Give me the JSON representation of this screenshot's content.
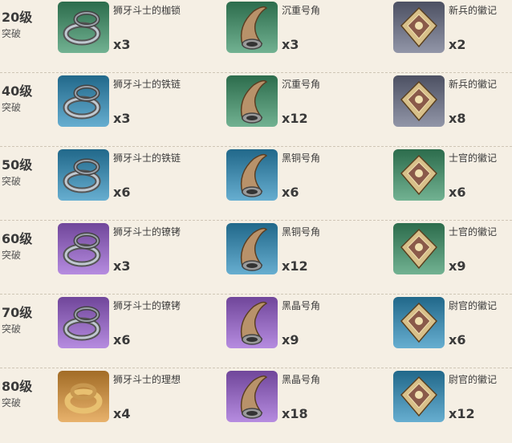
{
  "rows": [
    {
      "level": "20级",
      "sub": "突破",
      "items": [
        {
          "name": "狮牙斗士的枷锁",
          "count": "x3",
          "bg": "#4a8a6a",
          "icon": "shackle-icon"
        },
        {
          "name": "沉重号角",
          "count": "x3",
          "bg": "#4a8a6a",
          "icon": "horn-icon"
        },
        {
          "name": "新兵的徽记",
          "count": "x2",
          "bg": "#6a6e80",
          "icon": "insignia-icon"
        }
      ]
    },
    {
      "level": "40级",
      "sub": "突破",
      "items": [
        {
          "name": "狮牙斗士的铁链",
          "count": "x3",
          "bg": "#3f86a8",
          "icon": "chain-icon"
        },
        {
          "name": "沉重号角",
          "count": "x12",
          "bg": "#4a8a6a",
          "icon": "horn-icon"
        },
        {
          "name": "新兵的徽记",
          "count": "x8",
          "bg": "#6a6e80",
          "icon": "insignia-icon"
        }
      ]
    },
    {
      "level": "50级",
      "sub": "突破",
      "items": [
        {
          "name": "狮牙斗士的铁链",
          "count": "x6",
          "bg": "#3f86a8",
          "icon": "chain-icon"
        },
        {
          "name": "黑铜号角",
          "count": "x6",
          "bg": "#3f86a8",
          "icon": "horn-icon"
        },
        {
          "name": "士官的徽记",
          "count": "x6",
          "bg": "#4a8a6a",
          "icon": "insignia-icon"
        }
      ]
    },
    {
      "level": "60级",
      "sub": "突破",
      "items": [
        {
          "name": "狮牙斗士的镣铐",
          "count": "x3",
          "bg": "#8e64b8",
          "icon": "cuff-icon"
        },
        {
          "name": "黑铜号角",
          "count": "x12",
          "bg": "#3f86a8",
          "icon": "horn-icon"
        },
        {
          "name": "士官的徽记",
          "count": "x9",
          "bg": "#4a8a6a",
          "icon": "insignia-icon"
        }
      ]
    },
    {
      "level": "70级",
      "sub": "突破",
      "items": [
        {
          "name": "狮牙斗士的镣铐",
          "count": "x6",
          "bg": "#8e64b8",
          "icon": "cuff-icon"
        },
        {
          "name": "黑晶号角",
          "count": "x9",
          "bg": "#8e64b8",
          "icon": "horn-icon"
        },
        {
          "name": "尉官的徽记",
          "count": "x6",
          "bg": "#3f86a8",
          "icon": "insignia-icon"
        }
      ]
    },
    {
      "level": "80级",
      "sub": "突破",
      "items": [
        {
          "name": "狮牙斗士的理想",
          "count": "x4",
          "bg": "#c08a44",
          "icon": "ring-icon"
        },
        {
          "name": "黑晶号角",
          "count": "x18",
          "bg": "#8e64b8",
          "icon": "horn-icon"
        },
        {
          "name": "尉官的徽记",
          "count": "x12",
          "bg": "#3f86a8",
          "icon": "insignia-icon"
        }
      ]
    }
  ]
}
